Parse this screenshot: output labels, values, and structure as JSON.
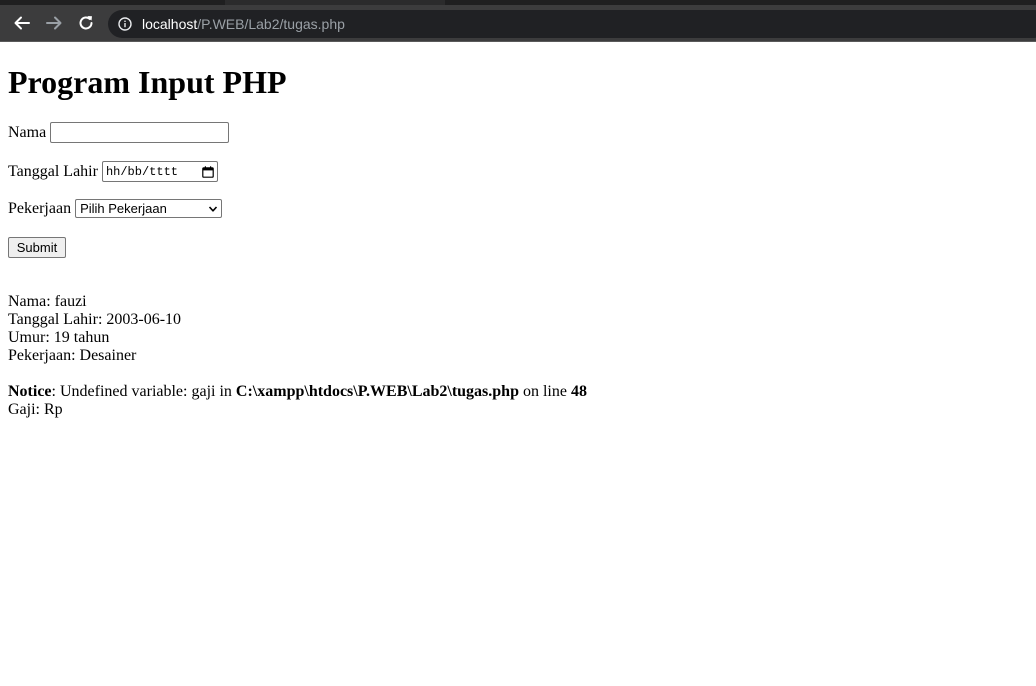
{
  "browser": {
    "url_host": "localhost",
    "url_path": "/P.WEB/Lab2/tugas.php"
  },
  "icons": {
    "back": "arrow-left-icon",
    "forward": "arrow-right-icon",
    "reload": "reload-icon",
    "site_info": "info-icon",
    "calendar": "calendar-icon",
    "dropdown": "chevron-down-icon"
  },
  "page": {
    "title": "Program Input PHP",
    "form": {
      "nama_label": "Nama",
      "nama_value": "",
      "tgl_label": "Tanggal Lahir",
      "tgl_placeholder": "hh/bb/tttt",
      "pekerjaan_label": "Pekerjaan",
      "pekerjaan_selected": "Pilih Pekerjaan",
      "submit_label": "Submit"
    },
    "output": {
      "nama": "Nama: fauzi",
      "tgl": "Tanggal Lahir: 2003-06-10",
      "umur": "Umur: 19 tahun",
      "pekerjaan": "Pekerjaan: Desainer",
      "notice_label": "Notice",
      "notice_text": ": Undefined variable: gaji in ",
      "notice_path": "C:\\xampp\\htdocs\\P.WEB\\Lab2\\tugas.php",
      "notice_on_line": " on line ",
      "notice_line_no": "48",
      "gaji": "Gaji: Rp"
    }
  },
  "colors": {
    "toolbar": "#3c3c3d",
    "omnibox": "#202124",
    "url_path": "#9aa0a6"
  }
}
